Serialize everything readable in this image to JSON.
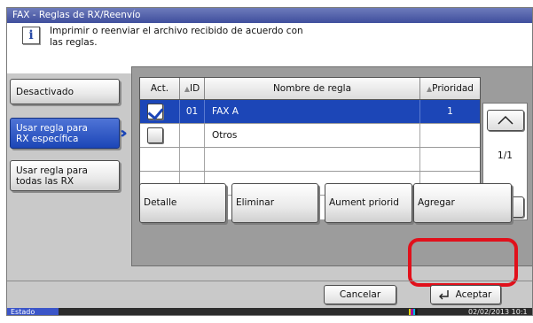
{
  "window": {
    "title": "FAX - Reglas de RX/Reenvío"
  },
  "message": {
    "icon": "info-icon",
    "text_line1": "Imprimir o reenviar el archivo recibido de acuerdo con",
    "text_line2": "las reglas."
  },
  "sidebar": {
    "items": [
      {
        "line1": "Desactivado",
        "line2": "",
        "selected": false
      },
      {
        "line1": "Usar regla para",
        "line2": "RX específica",
        "selected": true
      },
      {
        "line1": "Usar regla para",
        "line2": "todas las RX",
        "selected": false
      }
    ]
  },
  "table": {
    "headers": {
      "act": "Act.",
      "id": "ID",
      "name": "Nombre de regla",
      "priority": "Prioridad"
    },
    "rows": [
      {
        "checked": true,
        "id": "01",
        "name": "FAX A",
        "priority": "1",
        "selected": true
      },
      {
        "checked": false,
        "id": "",
        "name": "Otros",
        "priority": "",
        "selected": false
      }
    ]
  },
  "pager": {
    "page": "1/1"
  },
  "actions": {
    "detalle": "Detalle",
    "eliminar": "Eliminar",
    "aument": "Aument priorid",
    "agregar": "Agregar"
  },
  "footer": {
    "cancel": "Cancelar",
    "accept": "Aceptar"
  },
  "status": {
    "label": "Estado",
    "datetime": "02/02/2013 10:1"
  },
  "colors": {
    "selection": "#1c46b7",
    "highlight": "#e1101b",
    "title_bar": "#3f4e9d"
  }
}
